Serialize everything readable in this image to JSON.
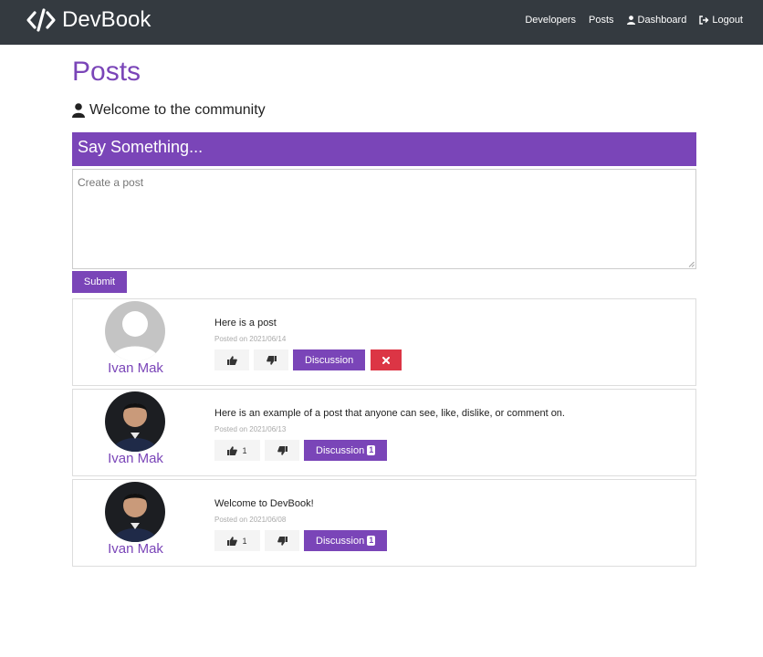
{
  "navbar": {
    "brand": "DevBook",
    "links": {
      "developers": "Developers",
      "posts": "Posts",
      "dashboard": "Dashboard",
      "logout": "Logout"
    }
  },
  "page": {
    "title": "Posts",
    "lead": "Welcome to the community"
  },
  "form": {
    "header": "Say Something...",
    "placeholder": "Create a post",
    "value": "",
    "submit": "Submit"
  },
  "posts": [
    {
      "author": "Ivan Mak",
      "avatar": "default-avatar",
      "text": "Here is a post",
      "date": "Posted on 2021/06/14",
      "likes": "",
      "discussion_label": "Discussion",
      "comments": "",
      "can_delete": true
    },
    {
      "author": "Ivan Mak",
      "avatar": "photo-avatar",
      "text": "Here is an example of a post that anyone can see, like, dislike, or comment on.",
      "date": "Posted on 2021/06/13",
      "likes": "1",
      "discussion_label": "Discussion",
      "comments": "1",
      "can_delete": false
    },
    {
      "author": "Ivan Mak",
      "avatar": "photo-avatar",
      "text": "Welcome to DevBook!",
      "date": "Posted on 2021/06/08",
      "likes": "1",
      "discussion_label": "Discussion",
      "comments": "1",
      "can_delete": false
    }
  ],
  "colors": {
    "navbar": "#343a40",
    "primary": "#7a45b8",
    "danger": "#dc3545",
    "light": "#f4f4f4"
  }
}
